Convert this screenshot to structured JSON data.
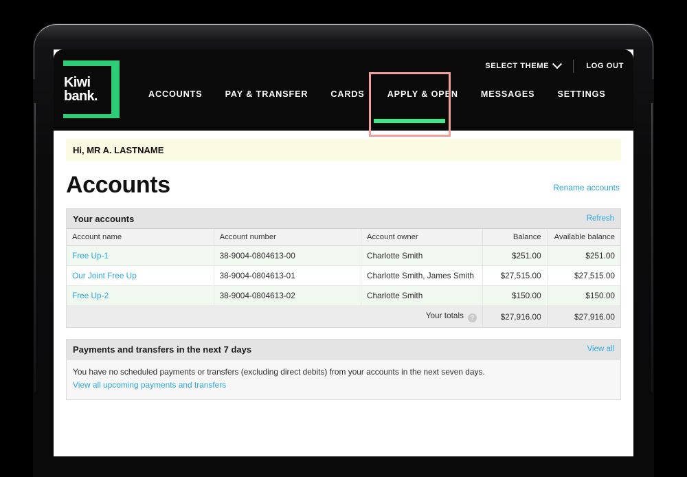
{
  "brand": {
    "logo_line1": "Kiwi",
    "logo_line2": "bank.",
    "green": "#2ecc77",
    "link_blue": "#2ba7e0",
    "highlight_pink": "#f0a099"
  },
  "utility": {
    "select_theme": "SELECT THEME",
    "chevron_icon": "chevron-down-icon",
    "log_out": "LOG OUT"
  },
  "nav": {
    "items": [
      {
        "label": "ACCOUNTS",
        "active": false
      },
      {
        "label": "PAY & TRANSFER",
        "active": false
      },
      {
        "label": "CARDS",
        "active": false
      },
      {
        "label": "APPLY & OPEN",
        "active": true
      },
      {
        "label": "MESSAGES",
        "active": false
      },
      {
        "label": "SETTINGS",
        "active": false
      }
    ]
  },
  "greeting": "Hi, MR A. LASTNAME",
  "page": {
    "title": "Accounts",
    "rename_link": "Rename accounts"
  },
  "accounts_panel": {
    "title": "Your accounts",
    "refresh_link": "Refresh",
    "columns": [
      "Account name",
      "Account number",
      "Account owner",
      "Balance",
      "Available balance"
    ],
    "rows": [
      {
        "name": "Free Up-1",
        "number": "38-9004-0804613-00",
        "owner": "Charlotte Smith",
        "balance": "$251.00",
        "available": "$251.00"
      },
      {
        "name": "Our Joint Free Up",
        "number": "38-9004-0804613-01",
        "owner": "Charlotte Smith, James Smith",
        "balance": "$27,515.00",
        "available": "$27,515.00"
      },
      {
        "name": "Free Up-2",
        "number": "38-9004-0804613-02",
        "owner": "Charlotte Smith",
        "balance": "$150.00",
        "available": "$150.00"
      }
    ],
    "totals": {
      "label": "Your totals",
      "help_icon": "help-question-icon",
      "help_glyph": "?",
      "balance": "$27,916.00",
      "available": "$27,916.00"
    }
  },
  "payments_panel": {
    "title": "Payments and transfers in the next 7 days",
    "view_all_link": "View all",
    "body_text": "You have no scheduled payments or transfers (excluding direct debits) from your accounts in the next seven days.",
    "body_link": "View all upcoming payments and transfers"
  }
}
